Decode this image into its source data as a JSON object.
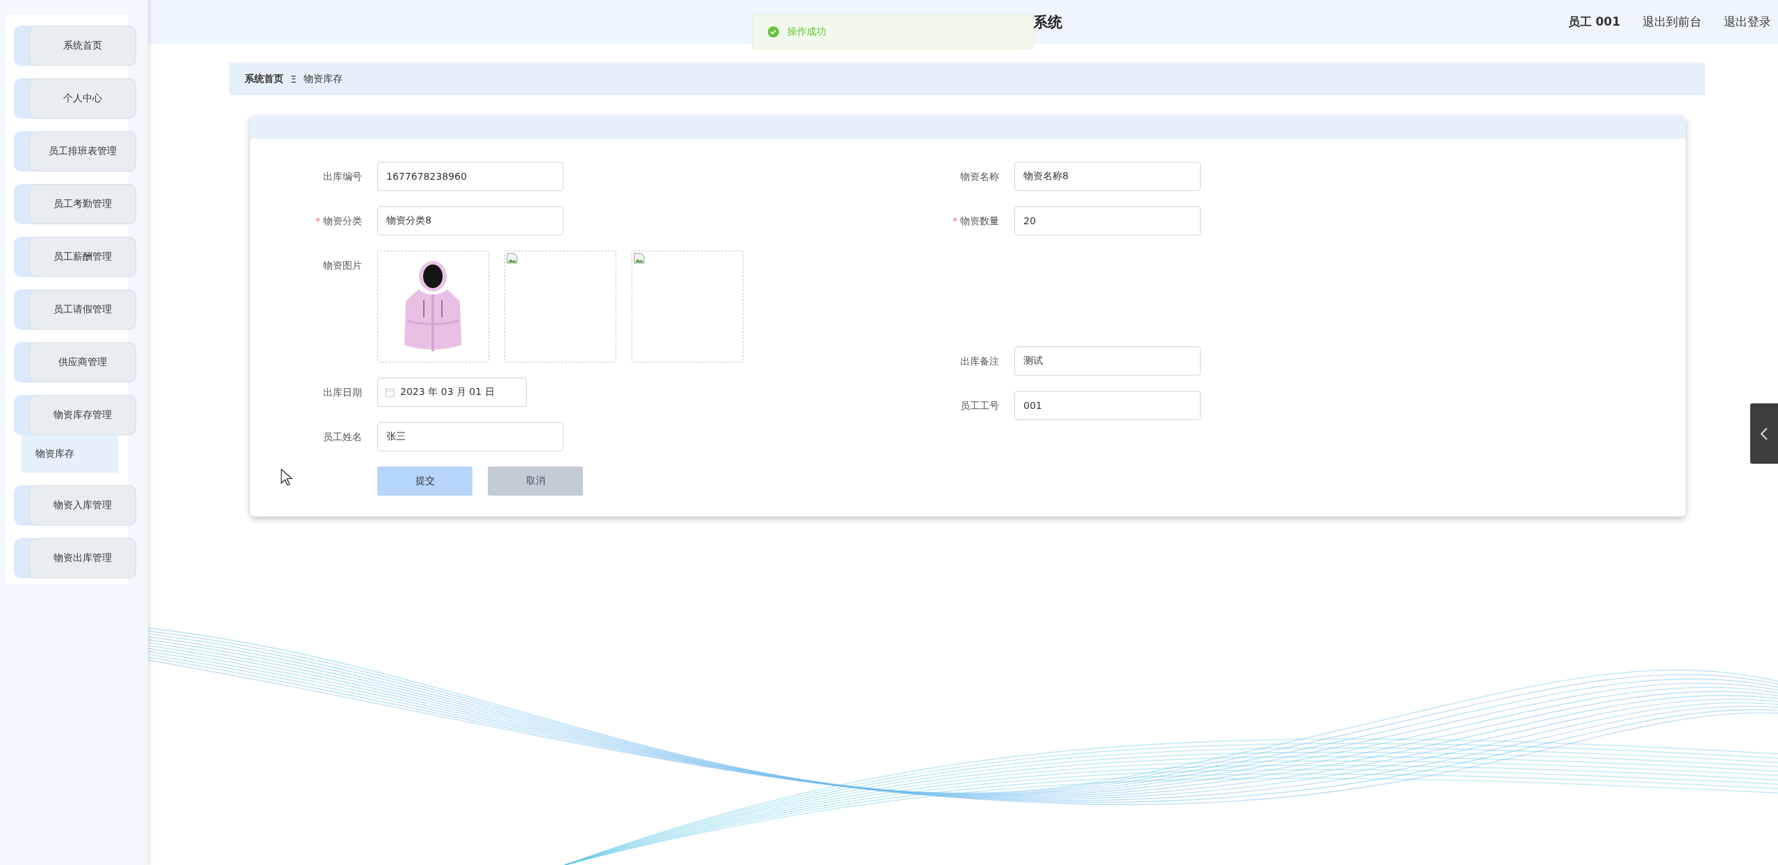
{
  "header": {
    "title": "系统",
    "user": "员工 001",
    "links": [
      "退出到前台",
      "退出登录"
    ]
  },
  "toast": {
    "kind": "success",
    "message": "操作成功"
  },
  "sidebar": {
    "items": [
      {
        "label": "系统首页",
        "selected": false
      },
      {
        "label": "个人中心",
        "selected": false
      },
      {
        "label": "员工排班表管理",
        "selected": false
      },
      {
        "label": "员工考勤管理",
        "selected": false
      },
      {
        "label": "员工薪酬管理",
        "selected": false
      },
      {
        "label": "员工请假管理",
        "selected": false
      },
      {
        "label": "供应商管理",
        "selected": false
      },
      {
        "label": "物资库存管理",
        "selected": false,
        "children": [
          {
            "label": "物资库存",
            "selected": true
          }
        ]
      },
      {
        "label": "物资入库管理",
        "selected": false
      },
      {
        "label": "物资出库管理",
        "selected": false
      }
    ]
  },
  "breadcrumb": {
    "items": [
      "系统首页",
      "物资库存"
    ],
    "separator": "Ξ"
  },
  "form": {
    "left": [
      {
        "kind": "text",
        "label": "出库编号",
        "value": "1677678238960"
      },
      {
        "kind": "text",
        "label": "物资分类",
        "required_mark": "*",
        "value": "物资分类8"
      },
      {
        "kind": "images",
        "label": "物资图片",
        "images": [
          {
            "kind": "picture"
          },
          {
            "kind": "broken"
          },
          {
            "kind": "broken"
          }
        ]
      },
      {
        "kind": "date",
        "label": "出库日期",
        "value": "2023 年 03 月 01 日"
      },
      {
        "kind": "text",
        "label": "员工姓名",
        "value": "张三"
      }
    ],
    "right": [
      {
        "kind": "text",
        "label": "物资名称",
        "value": "物资名称8"
      },
      {
        "kind": "text",
        "label": "物资数量",
        "required_mark": "*",
        "value": "20"
      },
      {
        "kind": "spacer"
      },
      {
        "kind": "text",
        "label": "出库备注",
        "value": "测试"
      },
      {
        "kind": "text",
        "label": "员工工号",
        "value": "001"
      }
    ],
    "buttons": [
      {
        "kind": "primary",
        "label": "提交"
      },
      {
        "kind": "secondary",
        "label": "取消"
      }
    ]
  }
}
